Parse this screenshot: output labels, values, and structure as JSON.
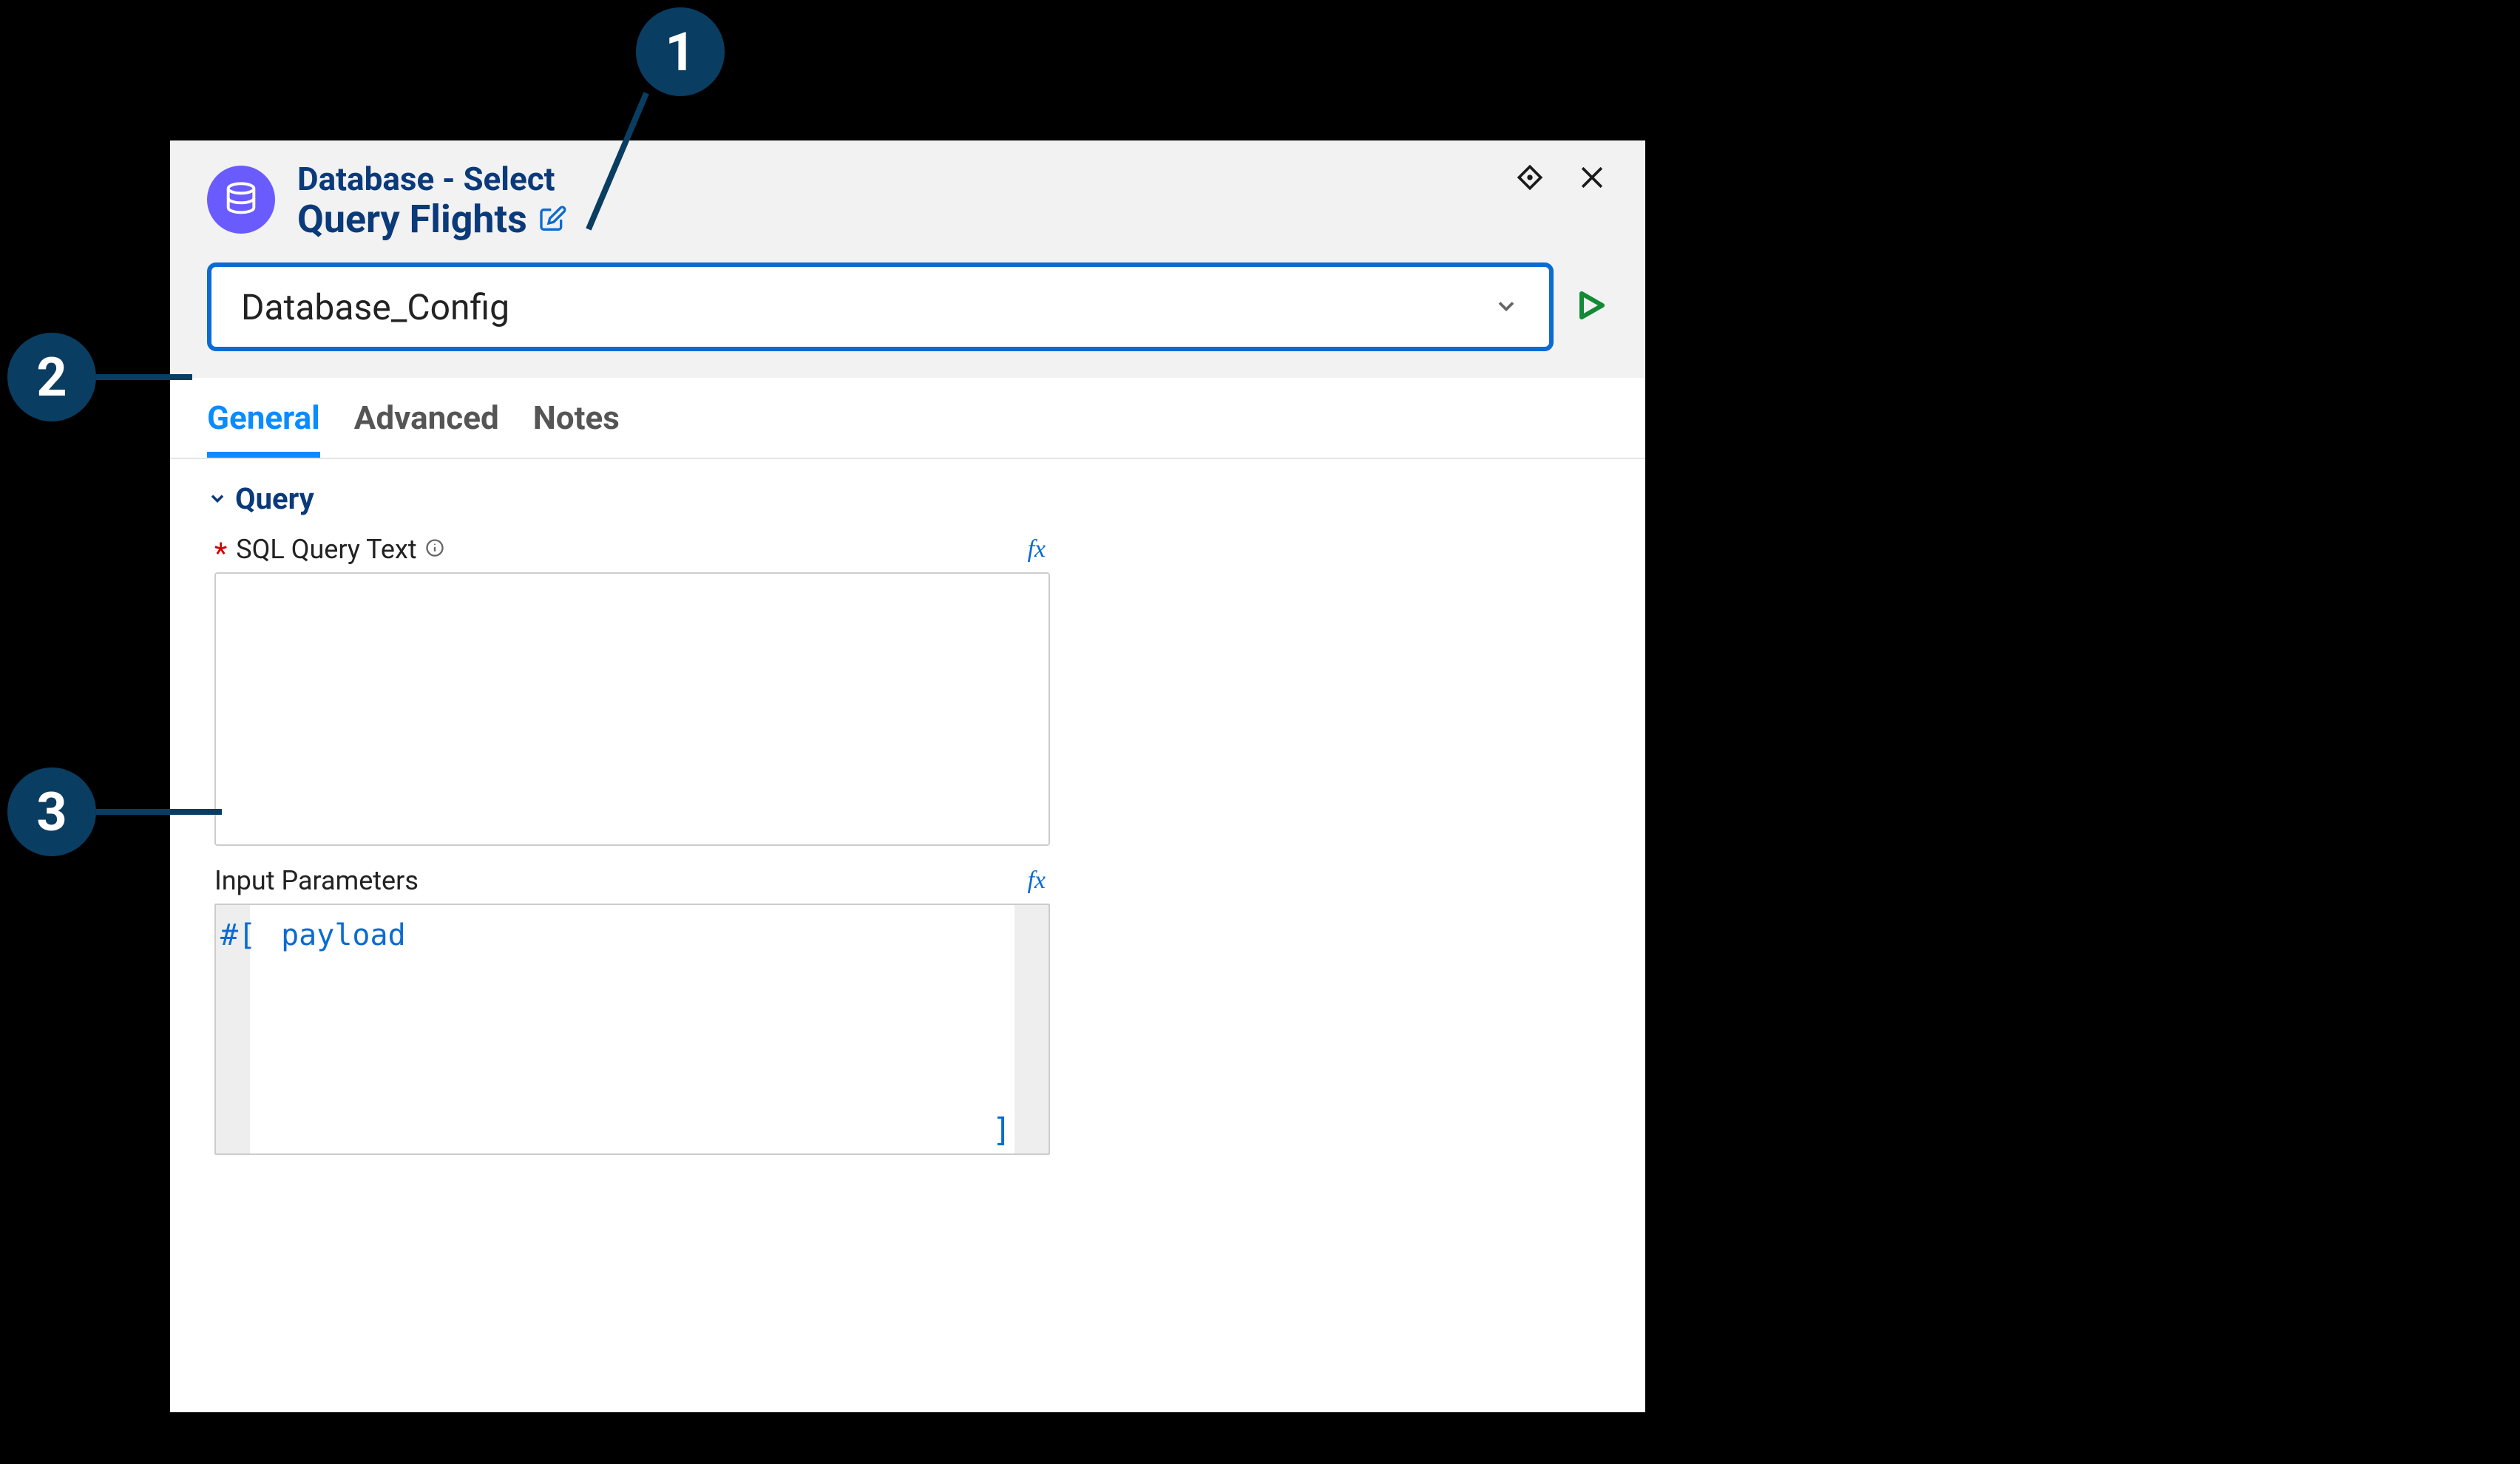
{
  "callouts": {
    "one": "1",
    "two": "2",
    "three": "3"
  },
  "header": {
    "type_label": "Database - Select",
    "title": "Query Flights"
  },
  "config": {
    "selected": "Database_Config"
  },
  "tabs": {
    "general": "General",
    "advanced": "Advanced",
    "notes": "Notes"
  },
  "section": {
    "query_header": "Query"
  },
  "fields": {
    "sql_label": "SQL Query Text",
    "sql_value": "",
    "input_params_label": "Input Parameters",
    "input_params_prefix": "#[",
    "input_params_value": " payload",
    "input_params_close": "]",
    "fx": "fx"
  }
}
